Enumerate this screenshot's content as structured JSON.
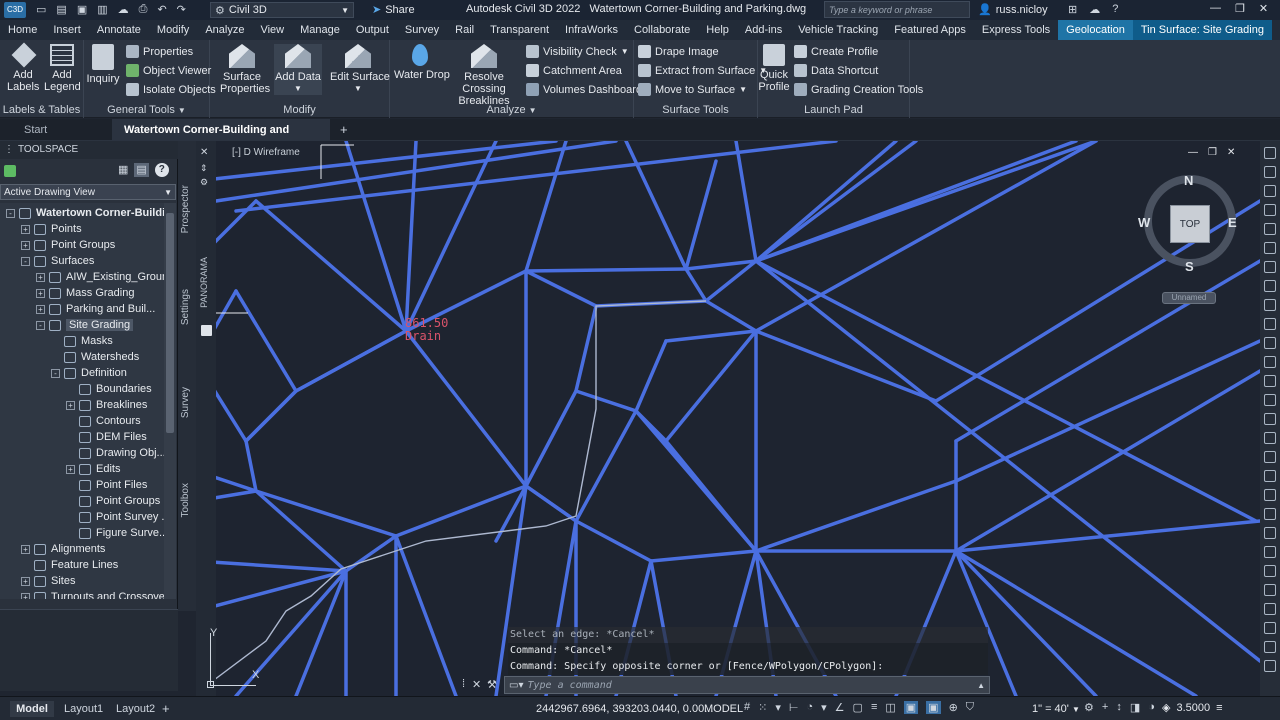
{
  "titlebar": {
    "app_icon": "C3D",
    "workspace": "Civil 3D",
    "share": "Share",
    "title": "Autodesk Civil 3D 2022",
    "filename": "Watertown Corner-Building and Parking.dwg",
    "search_placeholder": "Type a keyword or phrase",
    "user": "russ.nicloy"
  },
  "ribbon_tabs": [
    "Home",
    "Insert",
    "Annotate",
    "Modify",
    "Analyze",
    "View",
    "Manage",
    "Output",
    "Survey",
    "Rail",
    "Transparent",
    "InfraWorks",
    "Collaborate",
    "Help",
    "Add-ins",
    "Vehicle Tracking",
    "Featured Apps",
    "Express Tools",
    "Geolocation",
    "Tin Surface: Site Grading"
  ],
  "ribbon": {
    "labels_tables": {
      "title": "Labels & Tables",
      "add_labels": "Add Labels",
      "add_legend": "Add Legend"
    },
    "general_tools": {
      "title": "General Tools",
      "inquiry": "Inquiry",
      "properties": "Properties",
      "object_viewer": "Object Viewer",
      "isolate_objects": "Isolate Objects"
    },
    "modify": {
      "title": "Modify",
      "surface_properties": "Surface Properties",
      "add_data": "Add Data",
      "edit_surface": "Edit Surface"
    },
    "analyze": {
      "title": "Analyze",
      "water_drop": "Water Drop",
      "resolve_crossing": "Resolve Crossing Breaklines",
      "visibility_check": "Visibility Check",
      "catchment_area": "Catchment Area",
      "volumes_dashboard": "Volumes Dashboard"
    },
    "surface_tools": {
      "title": "Surface Tools",
      "drape_image": "Drape Image",
      "extract_from_surface": "Extract from Surface",
      "move_to_surface": "Move to Surface"
    },
    "launch_pad": {
      "title": "Launch Pad",
      "quick_profile": "Quick Profile",
      "create_profile": "Create Profile",
      "data_shortcut": "Data Shortcut",
      "grading_creation_tools": "Grading Creation Tools"
    }
  },
  "doc_tabs": {
    "start": "Start",
    "active": "Watertown Corner-Building and Parking*"
  },
  "toolspace": {
    "title": "TOOLSPACE",
    "view_selector": "Active Drawing View",
    "tree": [
      {
        "label": "Watertown Corner-Buildi...",
        "level": 0,
        "exp": "-"
      },
      {
        "label": "Points",
        "level": 1,
        "exp": "+"
      },
      {
        "label": "Point Groups",
        "level": 1,
        "exp": "+"
      },
      {
        "label": "Surfaces",
        "level": 1,
        "exp": "-"
      },
      {
        "label": "AIW_Existing_Ground",
        "level": 2,
        "exp": "+"
      },
      {
        "label": "Mass Grading",
        "level": 2,
        "exp": "+"
      },
      {
        "label": "Parking and Buil...",
        "level": 2,
        "exp": "+"
      },
      {
        "label": "Site Grading",
        "level": 2,
        "exp": "-",
        "selected": true
      },
      {
        "label": "Masks",
        "level": 3,
        "exp": ""
      },
      {
        "label": "Watersheds",
        "level": 3,
        "exp": ""
      },
      {
        "label": "Definition",
        "level": 3,
        "exp": "-"
      },
      {
        "label": "Boundaries",
        "level": 4,
        "exp": ""
      },
      {
        "label": "Breaklines",
        "level": 4,
        "exp": "+"
      },
      {
        "label": "Contours",
        "level": 4,
        "exp": ""
      },
      {
        "label": "DEM Files",
        "level": 4,
        "exp": ""
      },
      {
        "label": "Drawing Obj...",
        "level": 4,
        "exp": ""
      },
      {
        "label": "Edits",
        "level": 4,
        "exp": "+"
      },
      {
        "label": "Point Files",
        "level": 4,
        "exp": ""
      },
      {
        "label": "Point Groups",
        "level": 4,
        "exp": ""
      },
      {
        "label": "Point Survey ...",
        "level": 4,
        "exp": ""
      },
      {
        "label": "Figure Surve...",
        "level": 4,
        "exp": ""
      },
      {
        "label": "Alignments",
        "level": 1,
        "exp": "+"
      },
      {
        "label": "Feature Lines",
        "level": 1,
        "exp": ""
      },
      {
        "label": "Sites",
        "level": 1,
        "exp": "+"
      },
      {
        "label": "Turnouts and Crossovers",
        "level": 1,
        "exp": "+"
      }
    ],
    "side_tabs": [
      "Prospector",
      "Settings",
      "Survey",
      "Toolbox"
    ]
  },
  "viewport": {
    "view_label": "[-] D Wireframe",
    "panorama": "PANORAMA",
    "spot_elev": "861.50",
    "spot_desc": "Drain",
    "compass": {
      "n": "N",
      "s": "S",
      "e": "E",
      "w": "W",
      "top": "TOP"
    },
    "ucs_name": "Unnamed",
    "axis_y": "Y",
    "axis_x": "X"
  },
  "command": {
    "history": [
      "Select an edge: *Cancel*",
      "Command: *Cancel*",
      "Command: Specify opposite corner or [Fence/WPolygon/CPolygon]:"
    ],
    "placeholder": "Type a command"
  },
  "statusbar": {
    "tabs": [
      "Model",
      "Layout1",
      "Layout2"
    ],
    "coords": "2442967.6964, 393203.0440, 0.00...",
    "model": "MODEL",
    "scale": "1\" = 40'",
    "lineweight": "3.5000"
  },
  "colors": {
    "tin": "#4a6fe0",
    "label": "#d9536a",
    "ribbon_ctx": "#1f74a6"
  }
}
